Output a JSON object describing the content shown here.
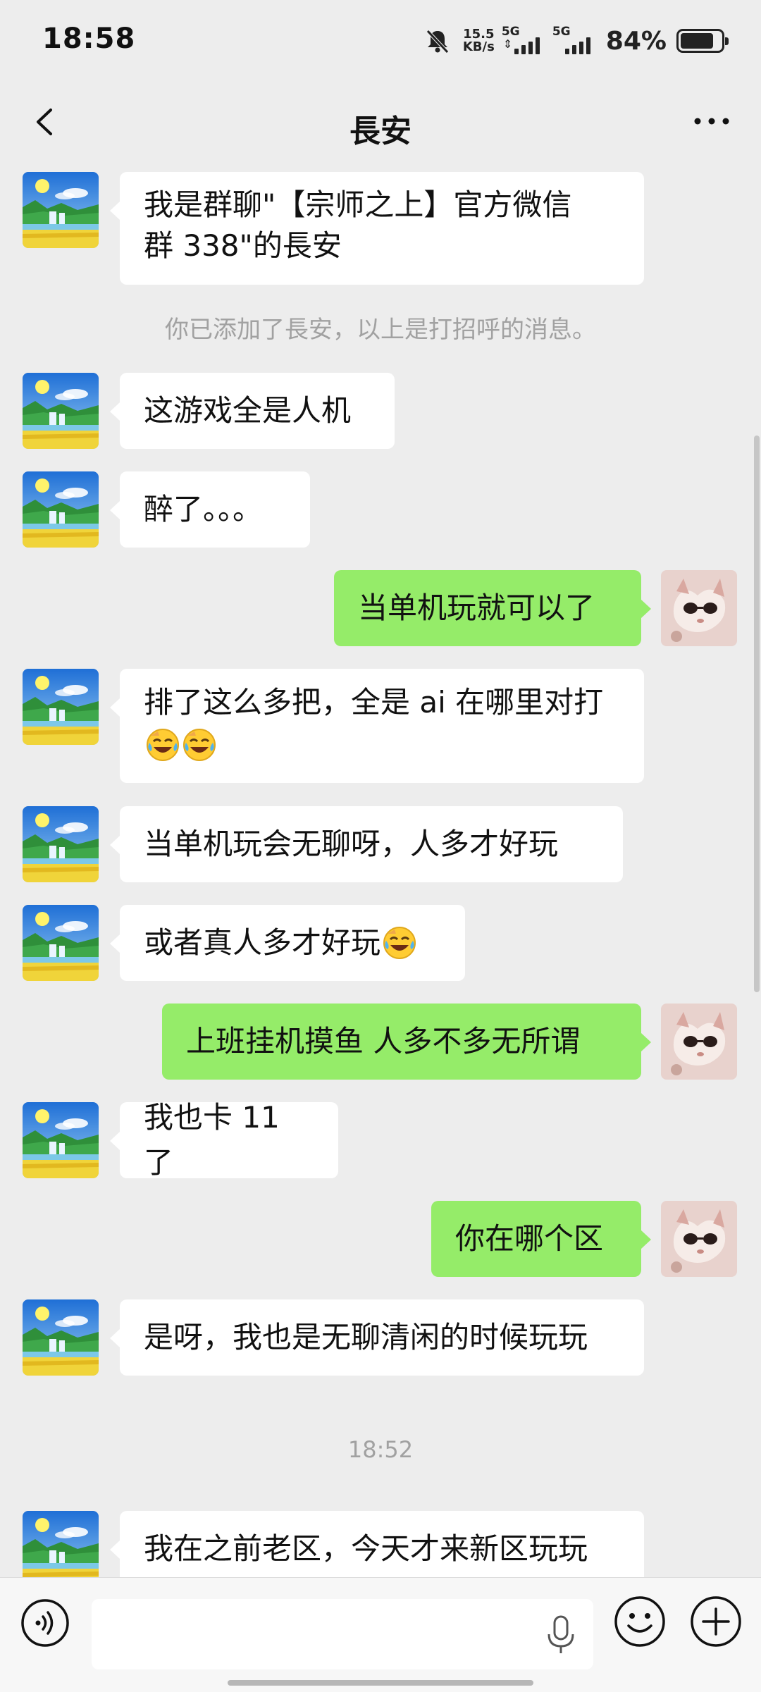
{
  "status_bar": {
    "time": "18:58",
    "net_speed_value": "15.5",
    "net_speed_unit": "KB/s",
    "network_1": "5G",
    "network_2": "5G",
    "battery": "84%",
    "icons": [
      "bell-off-icon",
      "signal-icon",
      "battery-icon"
    ]
  },
  "header": {
    "title": "長安",
    "back_icon": "chevron-left-icon",
    "more_icon": "more-icon"
  },
  "chat": {
    "msg_greeting_line1": "我是群聊\"【宗师之上】官方微信",
    "msg_greeting_line2": "群 338\"的長安",
    "system_notice": "你已添加了長安，以上是打招呼的消息。",
    "msg_2": "这游戏全是人机",
    "msg_3": "醉了。。。",
    "msg_4_self": "当单机玩就可以了",
    "msg_5_line1": "排了这么多把，全是 ai 在哪里对打",
    "msg_6": "当单机玩会无聊呀，人多才好玩",
    "msg_7": "或者真人多才好玩",
    "msg_8_self": "上班挂机摸鱼 人多不多无所谓",
    "msg_9": "我也卡 11 了",
    "msg_10_self": "你在哪个区",
    "msg_11": "是呀，我也是无聊清闲的时候玩玩",
    "timestamp": "18:52",
    "msg_12": "我在之前老区，今天才来新区玩玩"
  },
  "input_bar": {
    "voice_icon": "voice-icon",
    "mic_icon": "mic-icon",
    "emoji_icon": "emoji-icon",
    "plus_icon": "plus-icon"
  },
  "colors": {
    "background": "#ededed",
    "bubble_self": "#95ec69",
    "bubble_other": "#ffffff"
  }
}
